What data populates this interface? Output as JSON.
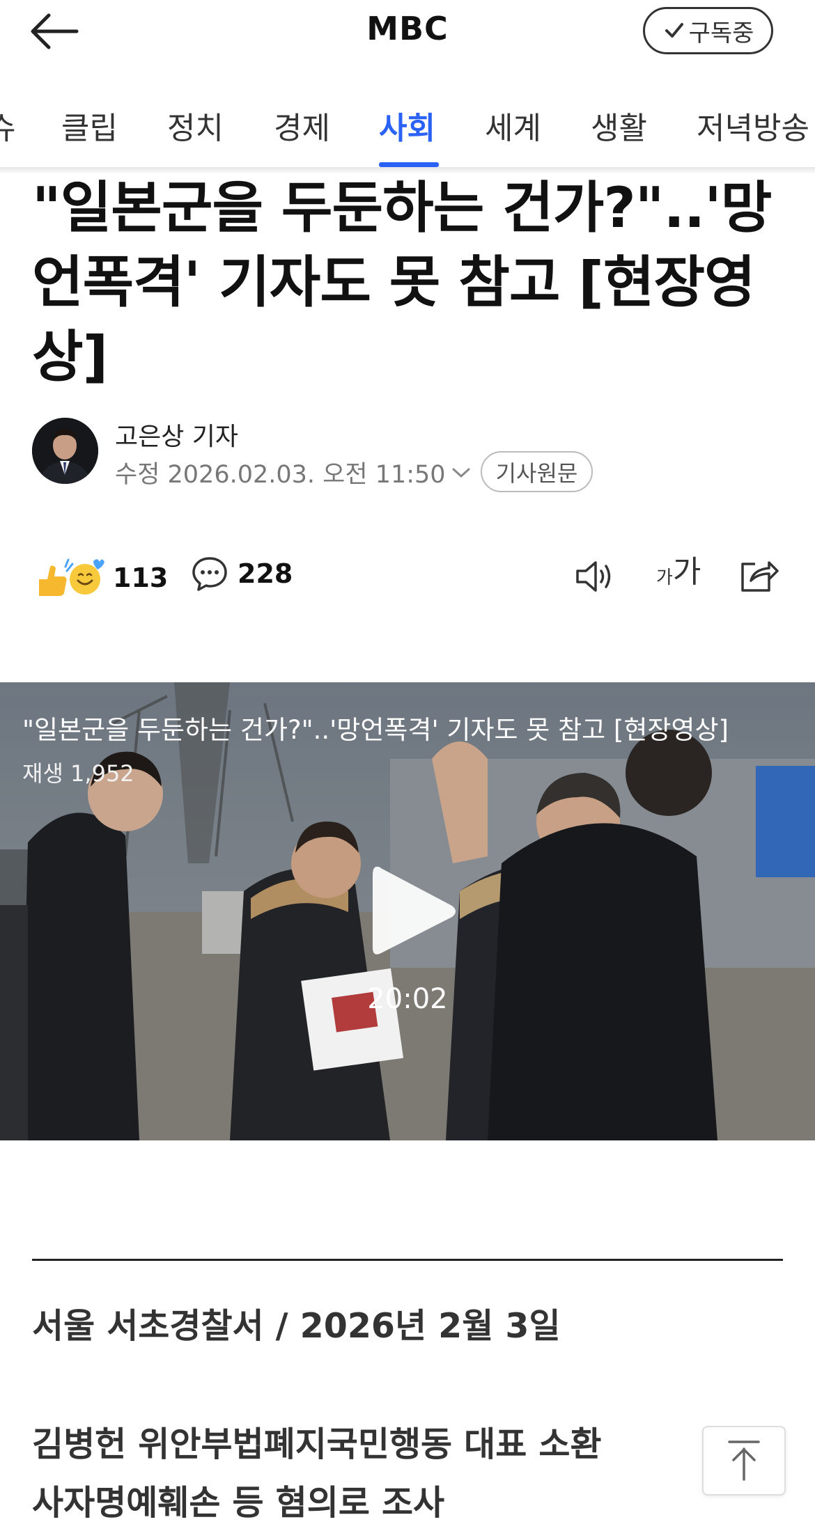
{
  "header": {
    "brand": "MBC",
    "subscribe_label": "구독중"
  },
  "tabs": [
    {
      "label": "슈"
    },
    {
      "label": "클립"
    },
    {
      "label": "정치"
    },
    {
      "label": "경제"
    },
    {
      "label": "사회",
      "active": true
    },
    {
      "label": "세계"
    },
    {
      "label": "생활"
    },
    {
      "label": "저녁방송"
    }
  ],
  "article": {
    "headline_lines": [
      "\"일본군을 두둔하는 건가?\"..'망",
      "언폭격' 기자도 못 참고 [현장영",
      "상]"
    ],
    "reporter": "고은상 기자",
    "date": "수정 2026.02.03. 오전 11:50",
    "original_label": "기사원문",
    "reaction_count": "113",
    "comment_count": "228",
    "font_size_label_small": "가",
    "font_size_label_large": "가"
  },
  "video": {
    "title": "\"일본군을 두둔하는 건가?\"..'망언폭격' 기자도 못 참고 [현장영상]",
    "views": "재생 1,952",
    "duration": "20:02"
  },
  "body": {
    "location": "서울 서초경찰서 / 2026년 2월 3일",
    "summary_lines": [
      "김병헌 위안부법폐지국민행동 대표 소환",
      "사자명예훼손 등 혐의로 조사"
    ]
  },
  "colors": {
    "accent": "#2a62f5",
    "text": "#111111",
    "muted": "#777777"
  }
}
